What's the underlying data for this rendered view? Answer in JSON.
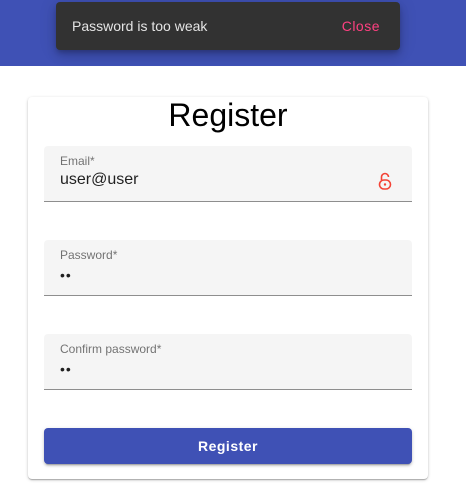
{
  "snackbar": {
    "message": "Password is too weak",
    "action_label": "Close"
  },
  "form": {
    "title": "Register",
    "email": {
      "label": "Email*",
      "value": "user@user",
      "icon": "lock-open-icon"
    },
    "password": {
      "label": "Password*",
      "value": "••"
    },
    "confirm_password": {
      "label": "Confirm password*",
      "value": "••"
    },
    "submit_label": "Register"
  },
  "colors": {
    "primary": "#3f51b5",
    "accent": "#ff4081",
    "warn_icon": "#f44336",
    "snackbar_bg": "#323232"
  }
}
